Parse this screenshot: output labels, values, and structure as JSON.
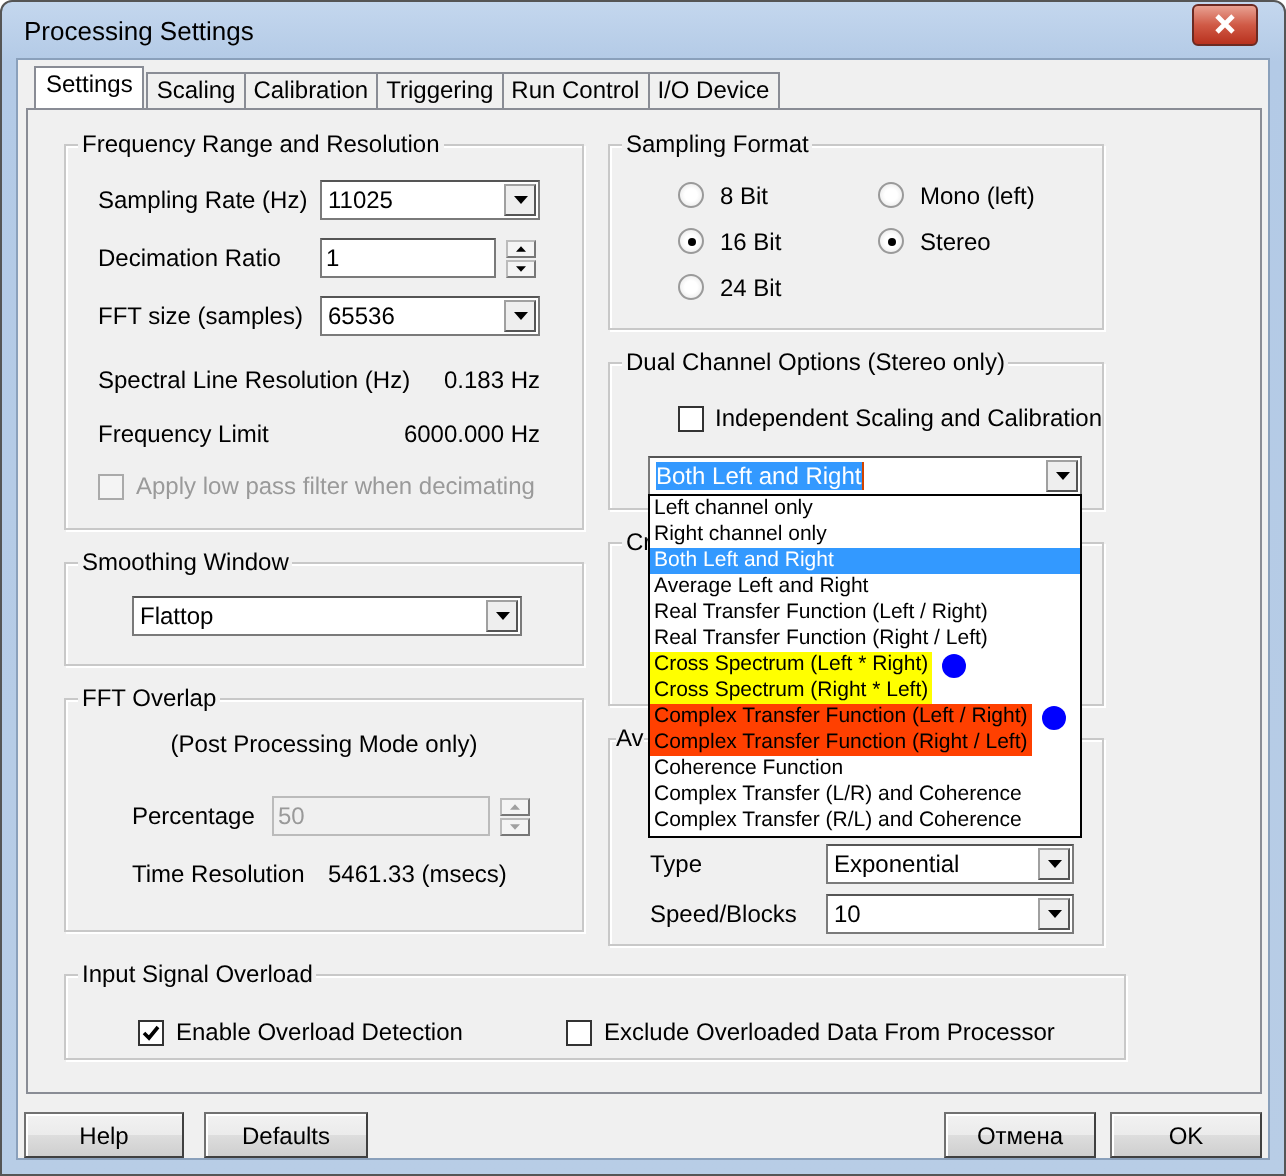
{
  "window": {
    "title": "Processing Settings"
  },
  "tabs": [
    {
      "label": "Settings",
      "selected": true
    },
    {
      "label": "Scaling",
      "selected": false
    },
    {
      "label": "Calibration",
      "selected": false
    },
    {
      "label": "Triggering",
      "selected": false
    },
    {
      "label": "Run Control",
      "selected": false
    },
    {
      "label": "I/O Device",
      "selected": false
    }
  ],
  "frequency": {
    "title": "Frequency Range and Resolution",
    "sampling_rate": {
      "label": "Sampling Rate (Hz)",
      "value": "11025"
    },
    "decimation": {
      "label": "Decimation Ratio",
      "value": "1"
    },
    "fft_size": {
      "label": "FFT size (samples)",
      "value": "65536"
    },
    "line_resolution": {
      "label": "Spectral Line Resolution (Hz)",
      "value": "0.183 Hz"
    },
    "frequency_limit": {
      "label": "Frequency Limit",
      "value": "6000.000 Hz"
    },
    "low_pass": {
      "label": "Apply low pass filter when decimating",
      "checked": false,
      "disabled": true
    }
  },
  "smoothing": {
    "title": "Smoothing Window",
    "value": "Flattop"
  },
  "overlap": {
    "title": "FFT Overlap",
    "note": "(Post Processing Mode only)",
    "percentage": {
      "label": "Percentage",
      "value": "50",
      "disabled": true
    },
    "time_resolution": {
      "label": "Time Resolution",
      "value": "5461.33 (msecs)"
    }
  },
  "sampling_format": {
    "title": "Sampling Format",
    "bits": [
      {
        "label": "8 Bit",
        "selected": false
      },
      {
        "label": "16 Bit",
        "selected": true
      },
      {
        "label": "24 Bit",
        "selected": false
      }
    ],
    "channels": [
      {
        "label": "Mono (left)",
        "selected": false
      },
      {
        "label": "Stereo",
        "selected": true
      }
    ]
  },
  "dual_channel": {
    "title": "Dual Channel Options (Stereo only)",
    "independent": {
      "label": "Independent Scaling and Calibration",
      "checked": false
    },
    "mode": {
      "value": "Both Left and Right",
      "expanded": true,
      "options": [
        {
          "label": "Left channel only",
          "selected": false,
          "dot": false
        },
        {
          "label": "Right channel only",
          "selected": false,
          "dot": false
        },
        {
          "label": "Both Left and Right",
          "selected": true,
          "dot": false
        },
        {
          "label": "Average Left and Right",
          "selected": false,
          "dot": false
        },
        {
          "label": "Real Transfer Function (Left / Right)",
          "selected": false,
          "dot": false
        },
        {
          "label": "Real Transfer Function (Right / Left)",
          "selected": false,
          "dot": false
        },
        {
          "label": "Cross Spectrum (Left * Right)",
          "selected": false,
          "dot": true,
          "color": "#ffff00"
        },
        {
          "label": "Cross Spectrum (Right * Left)",
          "selected": false,
          "dot": false,
          "color": "#ffff00"
        },
        {
          "label": "Complex Transfer Function (Left / Right)",
          "selected": false,
          "dot": true,
          "color": "#ff4000"
        },
        {
          "label": "Complex Transfer Function (Right / Left)",
          "selected": false,
          "dot": false,
          "color": "#ff4000"
        },
        {
          "label": "Coherence Function",
          "selected": false,
          "dot": false
        },
        {
          "label": "Complex Transfer (L/R) and Coherence",
          "selected": false,
          "dot": false
        },
        {
          "label": "Complex Transfer (R/L) and Coherence",
          "selected": false,
          "dot": false
        }
      ]
    }
  },
  "cross_group": {
    "title": "Cr"
  },
  "averaging": {
    "title": "Av",
    "type": {
      "label": "Type",
      "value": "Exponential"
    },
    "speed": {
      "label": "Speed/Blocks",
      "value": "10"
    }
  },
  "overload": {
    "title": "Input Signal Overload",
    "options": [
      {
        "label": "Enable Overload Detection",
        "checked": true
      },
      {
        "label": "Exclude Overloaded Data From Processor",
        "checked": false
      }
    ]
  },
  "buttons": [
    {
      "label": "Help",
      "kind": "left"
    },
    {
      "label": "Defaults",
      "kind": "left"
    },
    {
      "label": "Отмена",
      "kind": "right"
    },
    {
      "label": "OK",
      "kind": "right"
    }
  ]
}
